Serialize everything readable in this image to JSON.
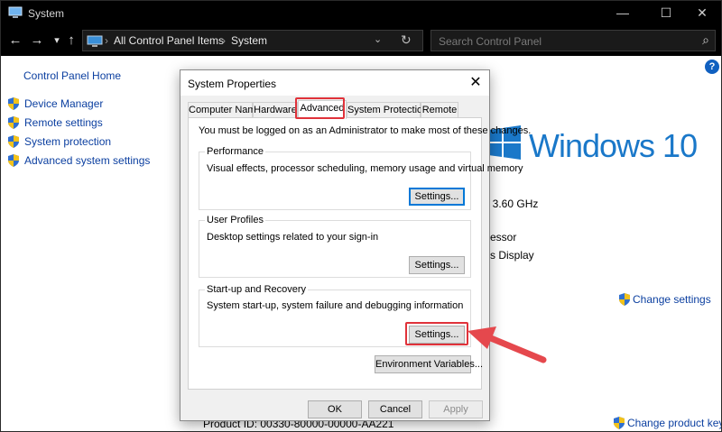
{
  "window": {
    "title": "System",
    "controls": {
      "minimize": "—",
      "maximize": "☐",
      "close": "✕"
    }
  },
  "nav": {
    "back": "←",
    "forward": "→",
    "recent": "▾",
    "up": "↑",
    "breadcrumb": [
      "All Control Panel Items",
      "System"
    ],
    "separator": "›",
    "dropdown": "⌄",
    "refresh": "↻",
    "search_placeholder": "Search Control Panel",
    "search_icon": "⌕"
  },
  "help_icon": "?",
  "sidebar": {
    "home": "Control Panel Home",
    "items": [
      {
        "label": "Device Manager",
        "icon": "shield-icon"
      },
      {
        "label": "Remote settings",
        "icon": "shield-icon"
      },
      {
        "label": "System protection",
        "icon": "shield-icon"
      },
      {
        "label": "Advanced system settings",
        "icon": "shield-icon"
      }
    ]
  },
  "background": {
    "windows_logo_text": "Windows 10",
    "processor_speed": ": 3.60 GHz",
    "processor_fragment": "essor",
    "display_fragment": "s Display",
    "change_settings": "Change settings",
    "change_product_key": "Change product key",
    "product_id": "Product ID: 00330-80000-00000-AA221"
  },
  "dialog": {
    "title": "System Properties",
    "close": "✕",
    "tabs": [
      "Computer Name",
      "Hardware",
      "Advanced",
      "System Protection",
      "Remote"
    ],
    "active_tab": "Advanced",
    "admin_note": "You must be logged on as an Administrator to make most of these changes.",
    "performance": {
      "title": "Performance",
      "description": "Visual effects, processor scheduling, memory usage and virtual memory",
      "button": "Settings..."
    },
    "user_profiles": {
      "title": "User Profiles",
      "description": "Desktop settings related to your sign-in",
      "button": "Settings..."
    },
    "startup_recovery": {
      "title": "Start-up and Recovery",
      "description": "System start-up, system failure and debugging information",
      "button": "Settings..."
    },
    "env_button": "Environment Variables...",
    "ok": "OK",
    "cancel": "Cancel",
    "apply": "Apply"
  },
  "colors": {
    "highlight": "#e0323a",
    "link": "#0b3fa0",
    "windows_blue": "#1a78c9",
    "titlebar": "#000000",
    "focus_blue": "#0078d7"
  }
}
